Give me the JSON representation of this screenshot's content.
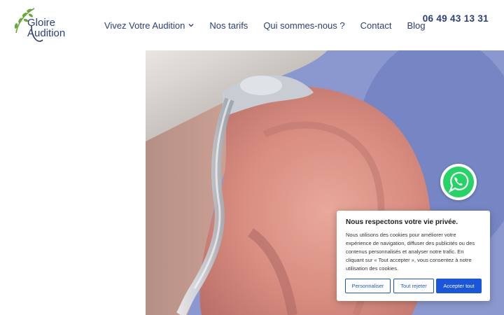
{
  "logo": {
    "line1": "Gloire",
    "line2": "Audition"
  },
  "nav": {
    "items": [
      {
        "label": "Vivez Votre Audition"
      },
      {
        "label": "Nos tarifs"
      },
      {
        "label": "Qui sommes-nous ?"
      },
      {
        "label": "Contact"
      },
      {
        "label": "Blog"
      }
    ]
  },
  "phone": "06 49 43 13 31",
  "cookie": {
    "title": "Nous respectons votre vie privée.",
    "text": "Nous utilisons des cookies pour améliorer votre expérience de navigation, diffuser des publicités ou des contenus personnalisés et analyser notre trafic. En cliquant sur « Tout accepter », vous consentez à notre utilisation des cookies.",
    "customize_label": "Personnaliser",
    "reject_label": "Tout rejeter",
    "accept_label": "Accepter tout"
  },
  "colors": {
    "brand_navy": "#2a3f7a",
    "logo_green": "#6aa83a",
    "button_blue": "#1a56db",
    "whatsapp_green": "#25d366"
  },
  "icons": {
    "nav_dropdown": "chevron-down-icon",
    "chat": "whatsapp-icon",
    "logo_leaf": "olive-branch-icon"
  }
}
